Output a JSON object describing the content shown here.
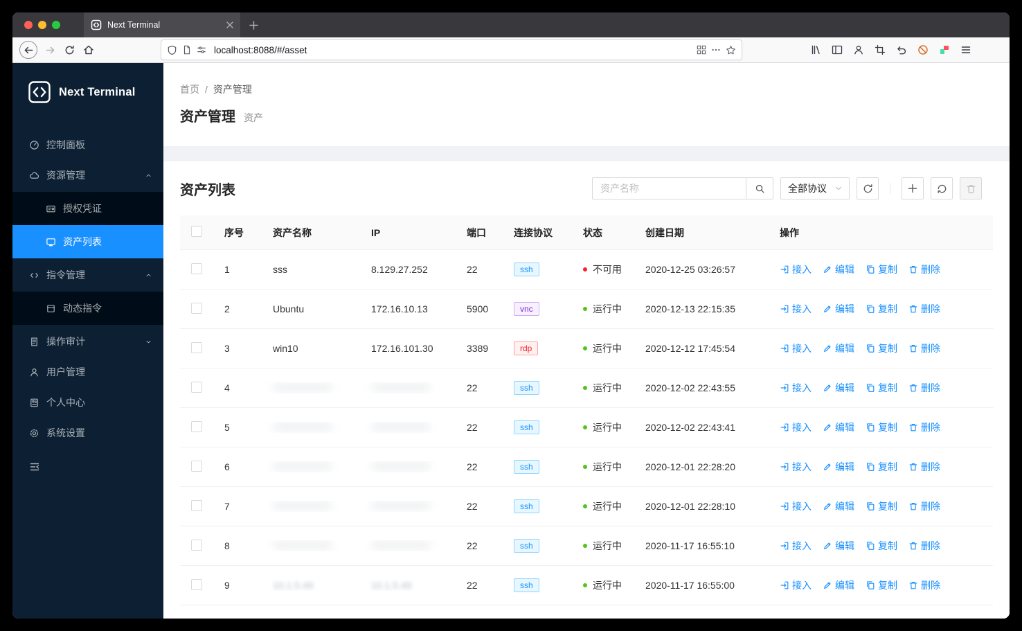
{
  "colors": {
    "accent": "#1890ff",
    "error": "#f5222d",
    "success": "#52c41a",
    "sidebar": "#0c1f33",
    "selected": "#1890ff"
  },
  "browser": {
    "tab_title": "Next Terminal",
    "url": "localhost:8088/#/asset"
  },
  "sidebar": {
    "logo_text": "Next Terminal",
    "items": [
      {
        "label": "控制面板",
        "icon": "dashboard-icon"
      },
      {
        "label": "资源管理",
        "icon": "resources-icon",
        "caret": "up"
      },
      {
        "label": "授权凭证",
        "icon": "credential-icon",
        "submenu": true
      },
      {
        "label": "资产列表",
        "icon": "asset-list-icon",
        "submenu": true,
        "selected": true
      },
      {
        "label": "指令管理",
        "icon": "command-icon",
        "caret": "up"
      },
      {
        "label": "动态指令",
        "icon": "dynamic-command-icon",
        "submenu": true
      },
      {
        "label": "操作审计",
        "icon": "audit-icon",
        "caret": "down"
      },
      {
        "label": "用户管理",
        "icon": "user-icon"
      },
      {
        "label": "个人中心",
        "icon": "profile-icon"
      },
      {
        "label": "系统设置",
        "icon": "settings-icon"
      }
    ]
  },
  "breadcrumb": {
    "items": [
      "首页",
      "资产管理"
    ],
    "separator": "/"
  },
  "page": {
    "title": "资产管理",
    "subtitle": "资产"
  },
  "card": {
    "title": "资产列表",
    "search_placeholder": "资产名称",
    "protocol_select": "全部协议"
  },
  "table": {
    "headers": [
      "序号",
      "资产名称",
      "IP",
      "端口",
      "连接协议",
      "状态",
      "创建日期",
      "操作"
    ],
    "actions": [
      {
        "label": "接入",
        "icon": "access-icon"
      },
      {
        "label": "编辑",
        "icon": "edit-icon"
      },
      {
        "label": "复制",
        "icon": "copy-icon"
      },
      {
        "label": "删除",
        "icon": "delete-icon"
      }
    ],
    "rows": [
      {
        "no": "1",
        "name": "sss",
        "ip": "8.129.27.252",
        "port": "22",
        "protocol": "ssh",
        "status": "不可用",
        "state": "error",
        "date": "2020-12-25 03:26:57",
        "masked": false
      },
      {
        "no": "2",
        "name": "Ubuntu",
        "ip": "172.16.10.13",
        "port": "5900",
        "protocol": "vnc",
        "status": "运行中",
        "state": "ok",
        "date": "2020-12-13 22:15:35",
        "masked": false
      },
      {
        "no": "3",
        "name": "win10",
        "ip": "172.16.101.30",
        "port": "3389",
        "protocol": "rdp",
        "status": "运行中",
        "state": "ok",
        "date": "2020-12-12 17:45:54",
        "masked": false
      },
      {
        "no": "4",
        "name": "",
        "ip": "",
        "port": "22",
        "protocol": "ssh",
        "status": "运行中",
        "state": "ok",
        "date": "2020-12-02 22:43:55",
        "masked": true
      },
      {
        "no": "5",
        "name": "",
        "ip": "",
        "port": "22",
        "protocol": "ssh",
        "status": "运行中",
        "state": "ok",
        "date": "2020-12-02 22:43:41",
        "masked": true
      },
      {
        "no": "6",
        "name": "",
        "ip": "",
        "port": "22",
        "protocol": "ssh",
        "status": "运行中",
        "state": "ok",
        "date": "2020-12-01 22:28:20",
        "masked": true
      },
      {
        "no": "7",
        "name": "",
        "ip": "",
        "port": "22",
        "protocol": "ssh",
        "status": "运行中",
        "state": "ok",
        "date": "2020-12-01 22:28:10",
        "masked": true
      },
      {
        "no": "8",
        "name": "",
        "ip": "",
        "port": "22",
        "protocol": "ssh",
        "status": "运行中",
        "state": "ok",
        "date": "2020-11-17 16:55:10",
        "masked": true
      },
      {
        "no": "9",
        "name": "10.1.5.49",
        "ip": "10.1.5.49",
        "port": "22",
        "protocol": "ssh",
        "status": "运行中",
        "state": "ok",
        "date": "2020-11-17 16:55:00",
        "masked": true
      }
    ]
  }
}
